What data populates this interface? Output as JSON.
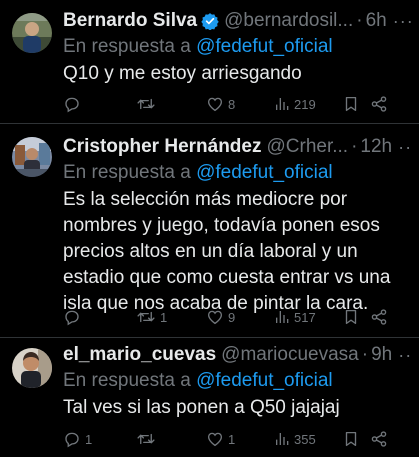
{
  "tweets": [
    {
      "name": "Bernardo Silva",
      "verified": true,
      "handle": "@bernardosil...",
      "dot": "·",
      "time": "6h",
      "more": "···",
      "reply_prefix": "En respuesta a",
      "reply_mention": "@fedefut_oficial",
      "text": "Q10 y me estoy arriesgando",
      "replies": "",
      "retweets": "",
      "likes": "8",
      "views": "219"
    },
    {
      "name": "Cristopher Hernández",
      "verified": false,
      "handle": "@Crher...",
      "dot": "·",
      "time": "12h",
      "more": "···",
      "reply_prefix": "En respuesta a",
      "reply_mention": "@fedefut_oficial",
      "text": "Es la selección más mediocre por nombres y juego, todavía ponen esos precios altos en un día laboral y un estadio que como cuesta entrar vs una isla que nos acaba de pintar la cara.",
      "replies": "",
      "retweets": "1",
      "likes": "9",
      "views": "517"
    },
    {
      "name": "el_mario_cuevas",
      "verified": false,
      "handle": "@mariocuevasa",
      "dot": "·",
      "time": "9h",
      "more": "···",
      "reply_prefix": "En respuesta a",
      "reply_mention": "@fedefut_oficial",
      "text": "Tal ves si las ponen a Q50 jajajaj",
      "replies": "1",
      "retweets": "",
      "likes": "1",
      "views": "355"
    }
  ],
  "colors": {
    "background": "#000000",
    "text": "#e7e9ea",
    "muted": "#71767b",
    "accent": "#1d9bf0",
    "divider": "#2f3336"
  },
  "icons": [
    "verified-badge-icon",
    "more-icon",
    "reply-icon",
    "retweet-icon",
    "like-icon",
    "views-icon",
    "bookmark-icon",
    "share-icon"
  ]
}
